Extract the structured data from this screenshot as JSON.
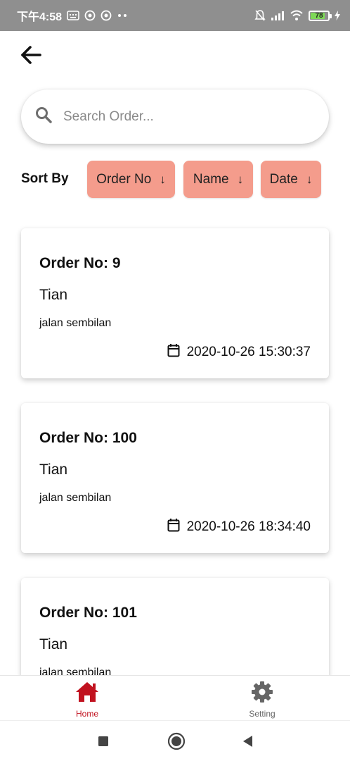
{
  "status_bar": {
    "time": "下午4:58",
    "battery_level": "78"
  },
  "search": {
    "placeholder": "Search Order...",
    "value": ""
  },
  "sort": {
    "label": "Sort By",
    "buttons": [
      {
        "label": "Order No",
        "arrow": "↓"
      },
      {
        "label": "Name",
        "arrow": "↓"
      },
      {
        "label": "Date",
        "arrow": "↓"
      }
    ]
  },
  "orders": [
    {
      "title": "Order No: 9",
      "name": "Tian",
      "address": "jalan sembilan",
      "date": "2020-10-26 15:30:37"
    },
    {
      "title": "Order No: 100",
      "name": "Tian",
      "address": "jalan sembilan",
      "date": "2020-10-26 18:34:40"
    },
    {
      "title": "Order No: 101",
      "name": "Tian",
      "address": "jalan sembilan",
      "date": ""
    }
  ],
  "bottom_nav": {
    "items": [
      {
        "label": "Home",
        "icon": "home-icon",
        "active": true
      },
      {
        "label": "Setting",
        "icon": "gear-icon",
        "active": false
      }
    ]
  },
  "colors": {
    "status_bar_bg": "#8f8f8f",
    "sort_button_bg": "#f49c8c",
    "nav_active": "#c1121f",
    "nav_inactive": "#666666",
    "battery_fill": "#7ed957"
  }
}
